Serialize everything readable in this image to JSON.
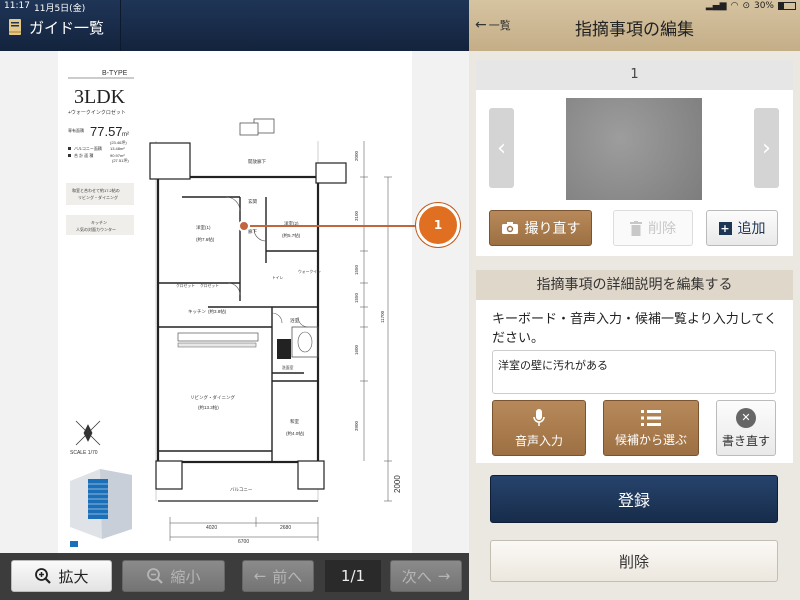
{
  "status_bar": {
    "time": "11:17",
    "date": "11月5日(金)",
    "battery": "30%"
  },
  "left_header": {
    "guide_label": "ガイド一覧"
  },
  "document": {
    "type_label": "B-TYPE",
    "layout": "3LDK",
    "layout_sub": "+ウォークインクロゼット",
    "area_label": "専有面積",
    "area_value": "77.57",
    "area_unit": "m²",
    "area_tsubo": "(23.46坪)",
    "balcony_label": "バルコニー面積",
    "balcony_value": "13.48m²",
    "total_label": "合 計 面 積",
    "total_value": "90.97m²",
    "total_tsubo": "(27.51坪)",
    "note1_lines": [
      "和室と合わせて約17.2帖の",
      "リビング・ダイニング"
    ],
    "note2_lines": [
      "キッチン",
      "人気の対面カウンター"
    ],
    "rooms": {
      "hall": "開放廊下",
      "entrance": "玄関",
      "room1": "洋室(1)",
      "room1_size": "(約7.6帖)",
      "room2": "洋室(2)",
      "room2_size": "(約5.7帖)",
      "corridor": "廊下",
      "kitchen": "キッチン",
      "kitchen_size": "(約3.8帖)",
      "bath": "浴室",
      "closet1": "クロゼット",
      "closet2": "クロゼット",
      "toilet": "トイレ",
      "wic": "ウォークイン",
      "washroom": "洗面室",
      "ldk": "リビング・ダイニング",
      "ldk_size": "(約13.3帖)",
      "washitsu": "和室",
      "washitsu_size": "(約4.0帖)",
      "balcony": "バルコニー"
    },
    "dimensions": {
      "bottom_total": "6700",
      "bottom_left": "4020",
      "bottom_right": "2680",
      "right_main": "11700",
      "right_balcony": "2000",
      "r1": "2000",
      "r2": "3100",
      "r3": "1550",
      "r4": "1550",
      "r5": "1600",
      "r6": "3900"
    },
    "scale_label": "SCALE 1/70"
  },
  "left_toolbar": {
    "zoom_in": "拡大",
    "zoom_out": "縮小",
    "prev": "前へ",
    "page": "1/1",
    "next": "次へ"
  },
  "marker": {
    "number": "1"
  },
  "right_header": {
    "back": "一覧",
    "title": "指摘事項の編集"
  },
  "photo_card": {
    "number": "1",
    "retake": "撮り直す",
    "delete": "削除",
    "add": "追加"
  },
  "detail": {
    "heading": "指摘事項の詳細説明を編集する",
    "instructions": "キーボード・音声入力・候補一覧より入力してください。",
    "description": "洋室の壁に汚れがある",
    "voice_input": "音声入力",
    "choose_candidates": "候補から選ぶ",
    "rewrite": "書き直す"
  },
  "actions": {
    "register": "登録",
    "delete": "削除"
  }
}
